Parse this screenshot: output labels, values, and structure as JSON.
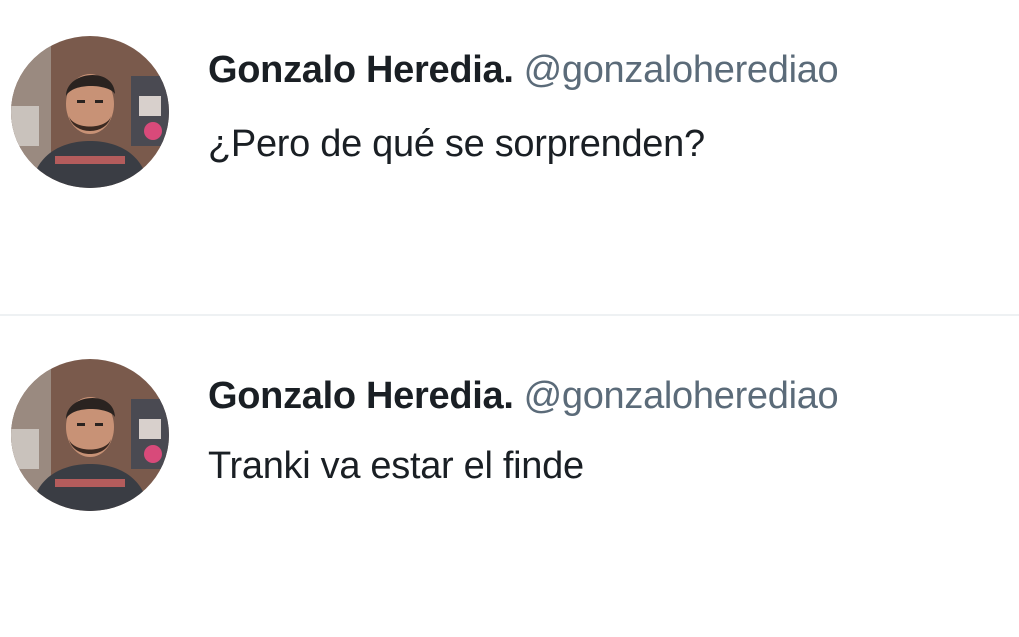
{
  "tweets": [
    {
      "display_name": "Gonzalo Heredia.",
      "handle": "@gonzaloherediao",
      "text": "¿Pero de qué se sorprenden?",
      "avatar": "profile-photo"
    },
    {
      "display_name": "Gonzalo Heredia.",
      "handle": "@gonzaloherediao",
      "text": "Tranki va estar el finde",
      "avatar": "profile-photo"
    }
  ],
  "colors": {
    "name": "#1a1f24",
    "handle": "#5b6b79",
    "text": "#1a1f24",
    "divider": "#eef1f3",
    "background": "#ffffff"
  }
}
